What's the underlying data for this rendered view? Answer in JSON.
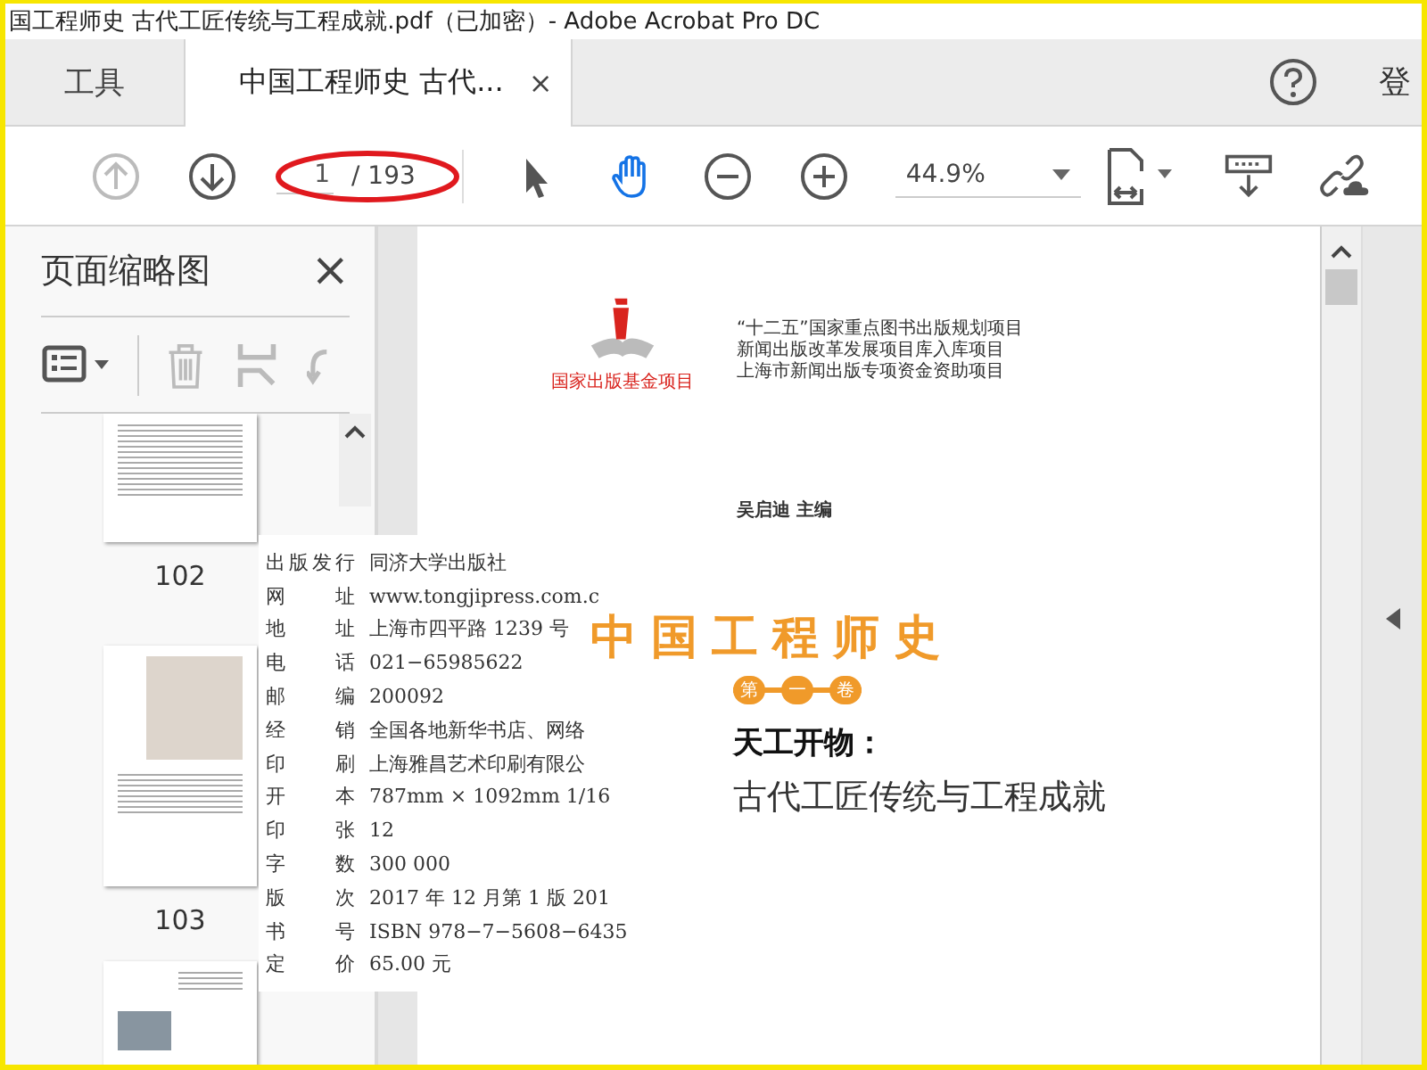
{
  "window": {
    "title": "国工程师史 古代工匠传统与工程成就.pdf（已加密）- Adobe Acrobat Pro DC"
  },
  "tabs": [
    {
      "label": "工具",
      "selected": false
    },
    {
      "label": "中国工程师史 古代...",
      "selected": true,
      "close": "×"
    }
  ],
  "account": {
    "label": "登"
  },
  "toolbar": {
    "page_value": "1",
    "page_total": "/ 193",
    "zoom": "44.9%",
    "tools": [
      {
        "kind": "prev",
        "disabled": true
      },
      {
        "kind": "next",
        "disabled": false
      },
      {
        "kind": "page"
      },
      {
        "kind": "select",
        "selected": false
      },
      {
        "kind": "hand",
        "selected": true
      },
      {
        "kind": "zoomout"
      },
      {
        "kind": "zoomin"
      },
      {
        "kind": "zoom"
      },
      {
        "kind": "fit"
      },
      {
        "kind": "scroll"
      },
      {
        "kind": "link"
      }
    ]
  },
  "sidebar": {
    "title": "页面缩略图",
    "close": "×",
    "thumbnails": [
      {
        "kind": "text",
        "label": "102"
      },
      {
        "kind": "figure",
        "label": "103"
      },
      {
        "kind": "photo"
      }
    ]
  },
  "document": {
    "logo_caption": "国家出版基金项目",
    "projects": [
      "“十二五”国家重点图书出版规划项目",
      "新闻出版改革发展项目库入库项目",
      "上海市新闻出版专项资金资助项目"
    ],
    "editor": "吴启迪 主编",
    "book_title": "中国工程师史",
    "volume": [
      "第",
      "一",
      "卷"
    ],
    "subtitle_bold": "天工开物：",
    "subtitle": "古代工匠传统与工程成就"
  },
  "colophon": [
    {
      "label": "出版发行",
      "value": "同济大学出版社"
    },
    {
      "label": "网址",
      "value": "www.tongjipress.com.c"
    },
    {
      "label": "地址",
      "value": "上海市四平路 1239 号"
    },
    {
      "label": "电话",
      "value": "021−65985622"
    },
    {
      "label": "邮编",
      "value": "200092"
    },
    {
      "label": "经销",
      "value": "全国各地新华书店、网络"
    },
    {
      "label": "印刷",
      "value": "上海雅昌艺术印刷有限公"
    },
    {
      "label": "开本",
      "value": "787mm × 1092mm  1/16"
    },
    {
      "label": "印张",
      "value": "12"
    },
    {
      "label": "字数",
      "value": "300 000"
    },
    {
      "label": "版次",
      "value": "2017 年 12 月第 1 版   201"
    },
    {
      "label": "书号",
      "value": "ISBN  978−7−5608−6435"
    },
    {
      "label": "定价",
      "value": "65.00 元"
    }
  ]
}
